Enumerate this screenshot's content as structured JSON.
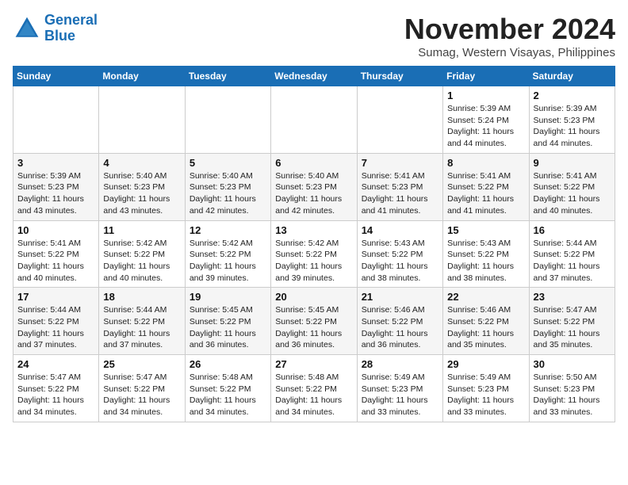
{
  "header": {
    "logo_line1": "General",
    "logo_line2": "Blue",
    "month": "November 2024",
    "location": "Sumag, Western Visayas, Philippines"
  },
  "weekdays": [
    "Sunday",
    "Monday",
    "Tuesday",
    "Wednesday",
    "Thursday",
    "Friday",
    "Saturday"
  ],
  "weeks": [
    [
      {
        "day": "",
        "info": ""
      },
      {
        "day": "",
        "info": ""
      },
      {
        "day": "",
        "info": ""
      },
      {
        "day": "",
        "info": ""
      },
      {
        "day": "",
        "info": ""
      },
      {
        "day": "1",
        "info": "Sunrise: 5:39 AM\nSunset: 5:24 PM\nDaylight: 11 hours\nand 44 minutes."
      },
      {
        "day": "2",
        "info": "Sunrise: 5:39 AM\nSunset: 5:23 PM\nDaylight: 11 hours\nand 44 minutes."
      }
    ],
    [
      {
        "day": "3",
        "info": "Sunrise: 5:39 AM\nSunset: 5:23 PM\nDaylight: 11 hours\nand 43 minutes."
      },
      {
        "day": "4",
        "info": "Sunrise: 5:40 AM\nSunset: 5:23 PM\nDaylight: 11 hours\nand 43 minutes."
      },
      {
        "day": "5",
        "info": "Sunrise: 5:40 AM\nSunset: 5:23 PM\nDaylight: 11 hours\nand 42 minutes."
      },
      {
        "day": "6",
        "info": "Sunrise: 5:40 AM\nSunset: 5:23 PM\nDaylight: 11 hours\nand 42 minutes."
      },
      {
        "day": "7",
        "info": "Sunrise: 5:41 AM\nSunset: 5:23 PM\nDaylight: 11 hours\nand 41 minutes."
      },
      {
        "day": "8",
        "info": "Sunrise: 5:41 AM\nSunset: 5:22 PM\nDaylight: 11 hours\nand 41 minutes."
      },
      {
        "day": "9",
        "info": "Sunrise: 5:41 AM\nSunset: 5:22 PM\nDaylight: 11 hours\nand 40 minutes."
      }
    ],
    [
      {
        "day": "10",
        "info": "Sunrise: 5:41 AM\nSunset: 5:22 PM\nDaylight: 11 hours\nand 40 minutes."
      },
      {
        "day": "11",
        "info": "Sunrise: 5:42 AM\nSunset: 5:22 PM\nDaylight: 11 hours\nand 40 minutes."
      },
      {
        "day": "12",
        "info": "Sunrise: 5:42 AM\nSunset: 5:22 PM\nDaylight: 11 hours\nand 39 minutes."
      },
      {
        "day": "13",
        "info": "Sunrise: 5:42 AM\nSunset: 5:22 PM\nDaylight: 11 hours\nand 39 minutes."
      },
      {
        "day": "14",
        "info": "Sunrise: 5:43 AM\nSunset: 5:22 PM\nDaylight: 11 hours\nand 38 minutes."
      },
      {
        "day": "15",
        "info": "Sunrise: 5:43 AM\nSunset: 5:22 PM\nDaylight: 11 hours\nand 38 minutes."
      },
      {
        "day": "16",
        "info": "Sunrise: 5:44 AM\nSunset: 5:22 PM\nDaylight: 11 hours\nand 37 minutes."
      }
    ],
    [
      {
        "day": "17",
        "info": "Sunrise: 5:44 AM\nSunset: 5:22 PM\nDaylight: 11 hours\nand 37 minutes."
      },
      {
        "day": "18",
        "info": "Sunrise: 5:44 AM\nSunset: 5:22 PM\nDaylight: 11 hours\nand 37 minutes."
      },
      {
        "day": "19",
        "info": "Sunrise: 5:45 AM\nSunset: 5:22 PM\nDaylight: 11 hours\nand 36 minutes."
      },
      {
        "day": "20",
        "info": "Sunrise: 5:45 AM\nSunset: 5:22 PM\nDaylight: 11 hours\nand 36 minutes."
      },
      {
        "day": "21",
        "info": "Sunrise: 5:46 AM\nSunset: 5:22 PM\nDaylight: 11 hours\nand 36 minutes."
      },
      {
        "day": "22",
        "info": "Sunrise: 5:46 AM\nSunset: 5:22 PM\nDaylight: 11 hours\nand 35 minutes."
      },
      {
        "day": "23",
        "info": "Sunrise: 5:47 AM\nSunset: 5:22 PM\nDaylight: 11 hours\nand 35 minutes."
      }
    ],
    [
      {
        "day": "24",
        "info": "Sunrise: 5:47 AM\nSunset: 5:22 PM\nDaylight: 11 hours\nand 34 minutes."
      },
      {
        "day": "25",
        "info": "Sunrise: 5:47 AM\nSunset: 5:22 PM\nDaylight: 11 hours\nand 34 minutes."
      },
      {
        "day": "26",
        "info": "Sunrise: 5:48 AM\nSunset: 5:22 PM\nDaylight: 11 hours\nand 34 minutes."
      },
      {
        "day": "27",
        "info": "Sunrise: 5:48 AM\nSunset: 5:22 PM\nDaylight: 11 hours\nand 34 minutes."
      },
      {
        "day": "28",
        "info": "Sunrise: 5:49 AM\nSunset: 5:23 PM\nDaylight: 11 hours\nand 33 minutes."
      },
      {
        "day": "29",
        "info": "Sunrise: 5:49 AM\nSunset: 5:23 PM\nDaylight: 11 hours\nand 33 minutes."
      },
      {
        "day": "30",
        "info": "Sunrise: 5:50 AM\nSunset: 5:23 PM\nDaylight: 11 hours\nand 33 minutes."
      }
    ]
  ]
}
